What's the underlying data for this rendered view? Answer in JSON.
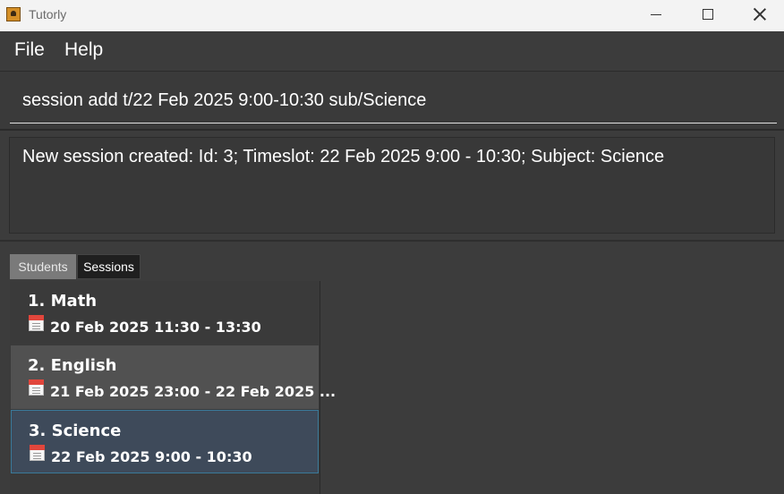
{
  "window": {
    "title": "Tutorly",
    "accent_color": "#d48f27"
  },
  "menu": {
    "file": "File",
    "help": "Help"
  },
  "command": {
    "value": "session add t/22 Feb 2025 9:00-10:30 sub/Science"
  },
  "result": {
    "text": "New session created: Id: 3; Timeslot: 22 Feb 2025 9:00 - 10:30; Subject: Science"
  },
  "tabs": [
    {
      "label": "Students",
      "selected": false
    },
    {
      "label": "Sessions",
      "selected": true
    }
  ],
  "sessions": [
    {
      "title": "1. Math",
      "timeslot": "20 Feb 2025 11:30 - 13:30",
      "icon": "calendar-icon"
    },
    {
      "title": "2. English",
      "timeslot": "21 Feb 2025 23:00 - 22 Feb 2025 ...",
      "icon": "calendar-icon"
    },
    {
      "title": "3. Science",
      "timeslot": "22 Feb 2025 9:00 - 10:30",
      "icon": "calendar-icon",
      "selected": true
    }
  ]
}
